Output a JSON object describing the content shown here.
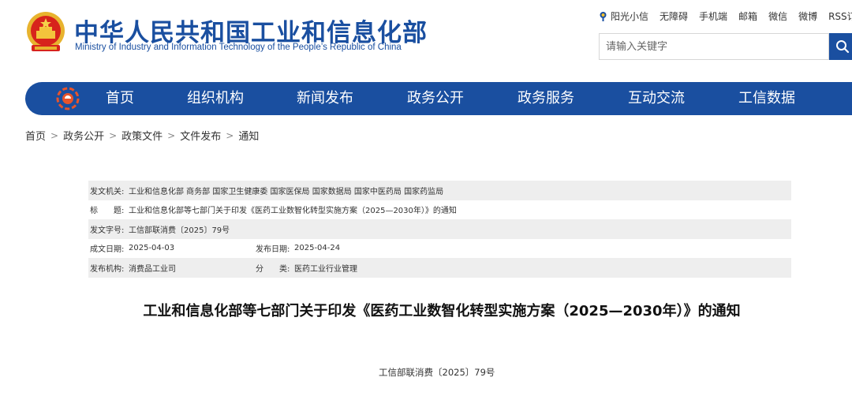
{
  "header": {
    "title": "中华人民共和国工业和信息化部",
    "subtitle": "Ministry of Industry and Information Technology of the People’s Republic of China",
    "links": [
      "阳光小信",
      "无障碍",
      "手机端",
      "邮箱",
      "微信",
      "微博",
      "RSS订阅"
    ],
    "search_placeholder": "请输入关键字",
    "brand_color": "#1a4fa0"
  },
  "nav": {
    "items": [
      "首页",
      "组织机构",
      "新闻发布",
      "政务公开",
      "政务服务",
      "互动交流",
      "工信数据"
    ]
  },
  "breadcrumb": [
    "首页",
    "政务公开",
    "政策文件",
    "文件发布",
    "通知"
  ],
  "meta": {
    "issuer_label": "发文机关:",
    "issuer_value": "工业和信息化部 商务部 国家卫生健康委 国家医保局 国家数据局 国家中医药局 国家药监局",
    "title_label": "标　　题:",
    "title_value": "工业和信息化部等七部门关于印发《医药工业数智化转型实施方案（2025—2030年）》的通知",
    "docno_label": "发文字号:",
    "docno_value": "工信部联消费〔2025〕79号",
    "created_label": "成文日期:",
    "created_value": "2025-04-03",
    "published_label": "发布日期:",
    "published_value": "2025-04-24",
    "agency_label": "发布机构:",
    "agency_value": "消费品工业司",
    "category_label": "分　　类:",
    "category_value": "医药工业行业管理"
  },
  "document": {
    "title": "工业和信息化部等七部门关于印发《医药工业数智化转型实施方案（2025—2030年）》的通知",
    "number": "工信部联消费〔2025〕79号"
  }
}
